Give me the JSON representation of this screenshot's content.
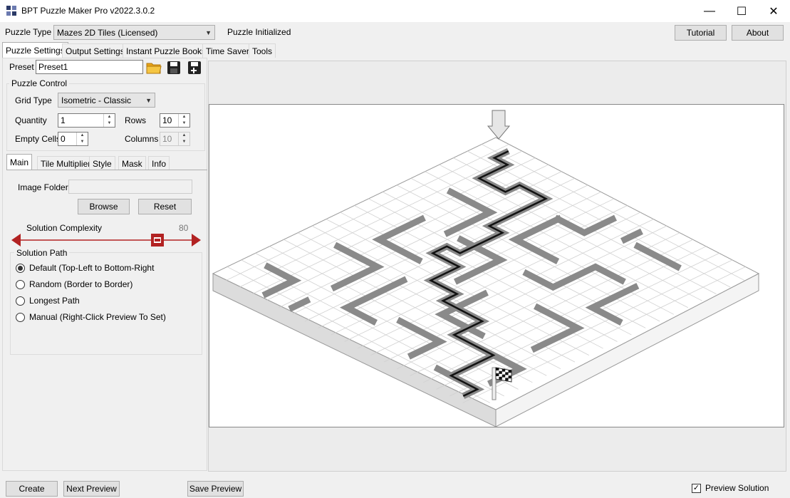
{
  "window": {
    "title": "BPT Puzzle Maker Pro v2022.3.0.2",
    "minimize_glyph": "—",
    "maximize_glyph": "☐",
    "close_glyph": "✕",
    "icon": "app-logo-icon"
  },
  "toolbar": {
    "puzzle_type_label": "Puzzle Type",
    "puzzle_type_value": "Mazes 2D Tiles (Licensed)",
    "status": "Puzzle Initialized",
    "tutorial": "Tutorial",
    "about": "About"
  },
  "tabs": [
    "Puzzle Settings",
    "Output Settings",
    "Instant Puzzle Books",
    "Time Saver",
    "Tools"
  ],
  "preset": {
    "label": "Preset",
    "value": "Preset1"
  },
  "puzzle_control": {
    "title": "Puzzle Control",
    "grid_type_label": "Grid Type",
    "grid_type_value": "Isometric - Classic",
    "quantity_label": "Quantity",
    "quantity_value": "1",
    "rows_label": "Rows",
    "rows_value": "10",
    "empty_cells_label": "Empty Cells",
    "empty_cells_value": "0",
    "columns_label": "Columns",
    "columns_value": "10"
  },
  "subtabs": [
    "Main",
    "Tile Multiplier",
    "Style",
    "Mask",
    "Info"
  ],
  "main": {
    "image_folder_label": "Image Folder",
    "image_folder_value": "",
    "browse": "Browse",
    "reset": "Reset",
    "complexity_label": "Solution Complexity",
    "complexity_value": "80",
    "complexity_fraction": 0.8,
    "solution_path_title": "Solution Path",
    "options": [
      {
        "label": "Default (Top-Left to Bottom-Right",
        "selected": true
      },
      {
        "label": "Random (Border to Border)",
        "selected": false
      },
      {
        "label": "Longest Path",
        "selected": false
      },
      {
        "label": "Manual (Right-Click Preview To Set)",
        "selected": false
      }
    ]
  },
  "bottom": {
    "create": "Create",
    "next_preview": "Next Preview",
    "save_preview": "Save Preview",
    "preview_solution": "Preview Solution",
    "preview_solution_checked": true
  },
  "colors": {
    "accent_red": "#b22222",
    "wall_grey": "#8a8a8a",
    "tile_white": "#ffffff"
  }
}
